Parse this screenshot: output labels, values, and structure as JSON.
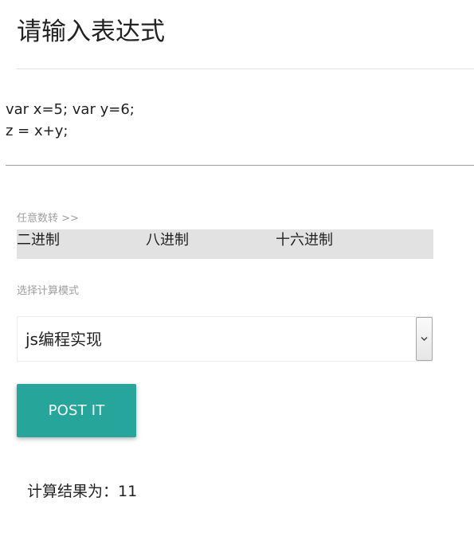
{
  "header": {
    "title": "请输入表达式"
  },
  "expression": {
    "value": "var x=5; var y=6;\nz = x+y;"
  },
  "converter": {
    "label": "任意数转 >>",
    "options": [
      "二进制",
      "八进制",
      "十六进制"
    ]
  },
  "mode": {
    "label": "选择计算模式",
    "selected": "js编程实现"
  },
  "submit": {
    "label": "POST IT"
  },
  "result": {
    "prefix": "计算结果为：",
    "value": "11"
  },
  "colors": {
    "accent": "#26a69a",
    "convert_bar": "#e2e2e2",
    "muted_text": "#9e9e9e"
  },
  "icons": {
    "select_arrow": "chevron-down-icon"
  }
}
